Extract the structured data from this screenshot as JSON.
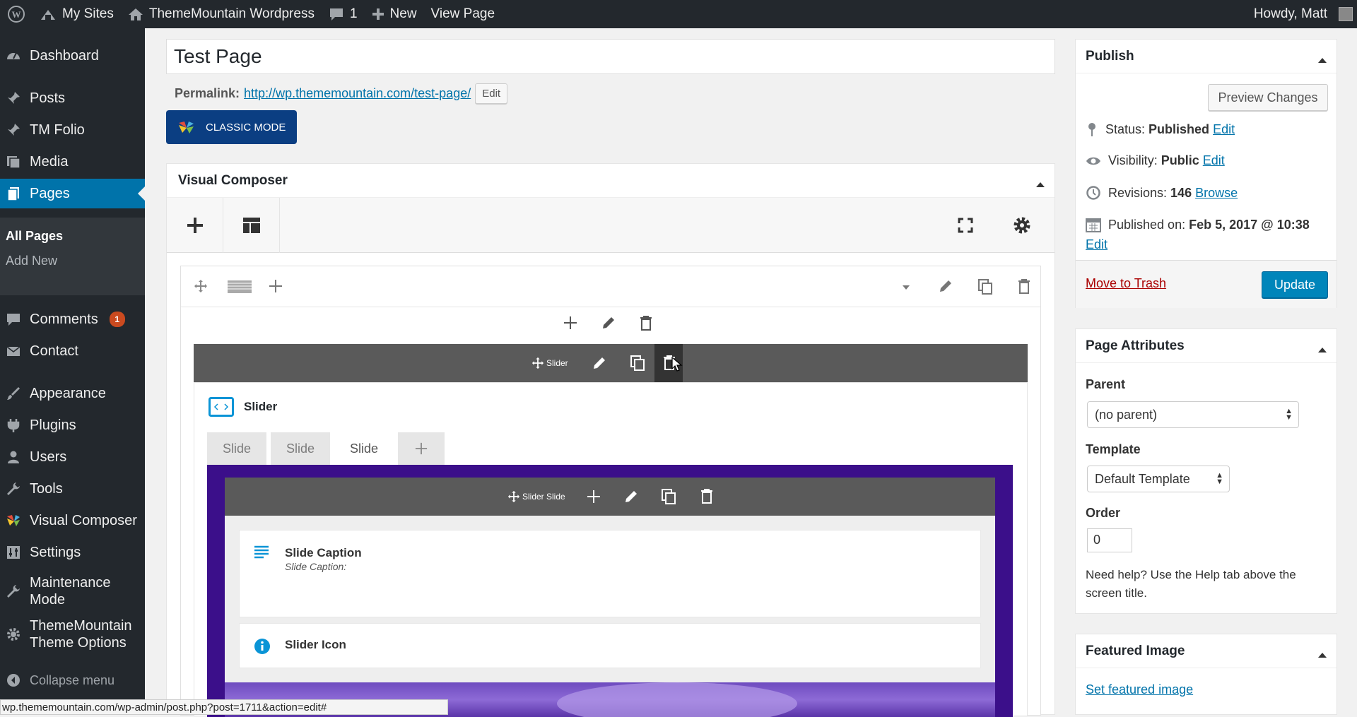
{
  "admin_bar": {
    "my_sites": "My Sites",
    "site_name": "ThemeMountain Wordpress",
    "comments_count": "1",
    "new_label": "New",
    "view_page": "View Page",
    "howdy": "Howdy, Matt"
  },
  "sidebar": {
    "dashboard": "Dashboard",
    "posts": "Posts",
    "tm_folio": "TM Folio",
    "media": "Media",
    "pages": "Pages",
    "all_pages": "All Pages",
    "add_new": "Add New",
    "comments": "Comments",
    "comments_badge": "1",
    "contact": "Contact",
    "appearance": "Appearance",
    "plugins": "Plugins",
    "users": "Users",
    "tools": "Tools",
    "visual_composer": "Visual Composer",
    "settings": "Settings",
    "maintenance_1": "Maintenance",
    "maintenance_2": "Mode",
    "theme_options_1": "ThemeMountain",
    "theme_options_2": "Theme Options",
    "collapse": "Collapse menu"
  },
  "editor": {
    "title": "Test Page",
    "permalink_label": "Permalink:",
    "permalink_url": "http://wp.thememountain.com/test-page/",
    "permalink_edit": "Edit",
    "classic_mode": "CLASSIC MODE"
  },
  "composer": {
    "heading": "Visual Composer",
    "slider_bar_label": "Slider",
    "slider_title": "Slider",
    "tabs": [
      "Slide",
      "Slide",
      "Slide"
    ],
    "active_tab": 2,
    "slide_bar_label": "Slider Slide",
    "caption_title": "Slide Caption",
    "caption_sub": "Slide Caption:",
    "icon_title": "Slider Icon",
    "slide_bg_color": "#3b0f8a"
  },
  "publish": {
    "heading": "Publish",
    "preview": "Preview Changes",
    "status_label": "Status:",
    "status_value": "Published",
    "status_edit": "Edit",
    "visibility_label": "Visibility:",
    "visibility_value": "Public",
    "visibility_edit": "Edit",
    "revisions_label": "Revisions:",
    "revisions_value": "146",
    "revisions_browse": "Browse",
    "published_label": "Published on:",
    "published_value": "Feb 5, 2017 @ 10:38",
    "published_edit": "Edit",
    "trash": "Move to Trash",
    "update": "Update"
  },
  "attributes": {
    "heading": "Page Attributes",
    "parent_label": "Parent",
    "parent_value": "(no parent)",
    "template_label": "Template",
    "template_value": "Default Template",
    "order_label": "Order",
    "order_value": "0",
    "help": "Need help? Use the Help tab above the screen title."
  },
  "featured": {
    "heading": "Featured Image",
    "set_link": "Set featured image"
  },
  "status_bar": "wp.thememountain.com/wp-admin/post.php?post=1711&action=edit#",
  "colors": {
    "admin_dark": "#23282d",
    "accent_blue": "#0073aa",
    "primary_button": "#0085ba",
    "classic_button": "#0b3e82",
    "badge": "#ca4a1f"
  }
}
